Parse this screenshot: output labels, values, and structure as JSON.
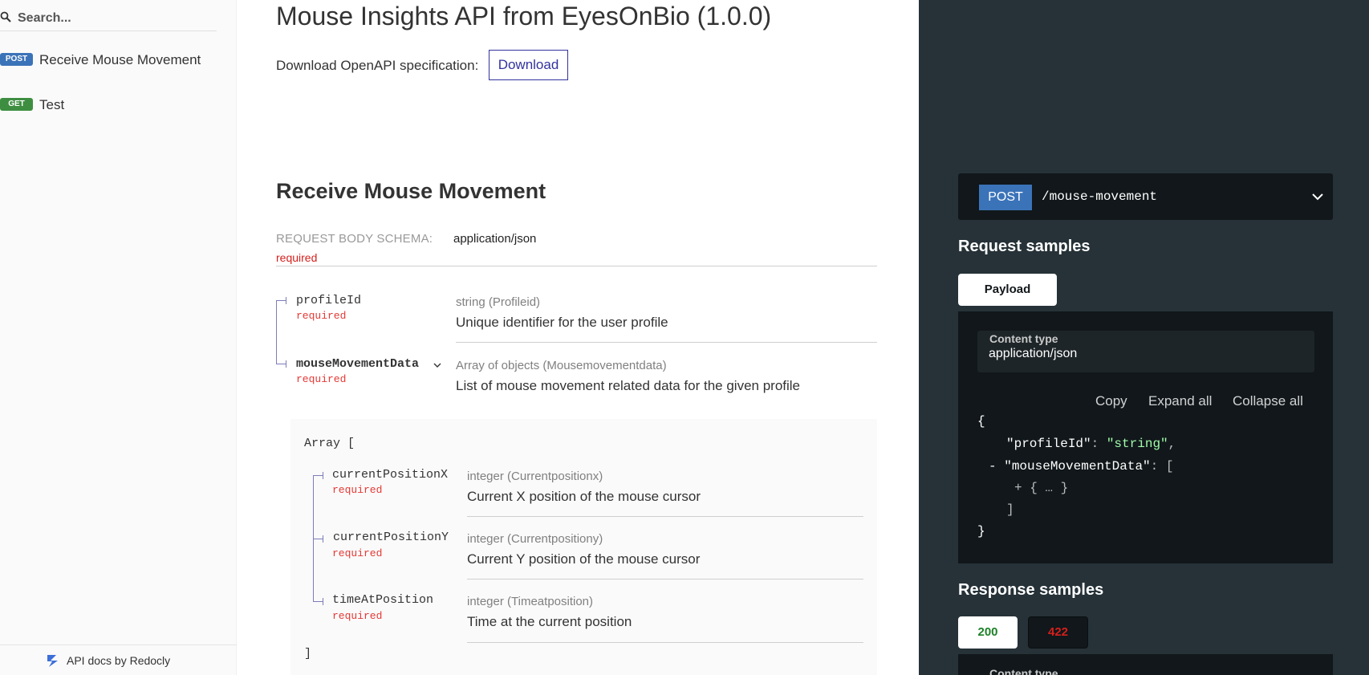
{
  "sidebar": {
    "search_placeholder": "Search...",
    "items": [
      {
        "method": "POST",
        "label": "Receive Mouse Movement",
        "color": "#3b73b9"
      },
      {
        "method": "GET",
        "label": "Test",
        "color": "#3e8e41"
      }
    ],
    "footer": "API docs by Redocly"
  },
  "main": {
    "api_title": "Mouse Insights API from EyesOnBio (1.0.0)",
    "download_text": "Download OpenAPI specification:",
    "download_button": "Download",
    "operation_title": "Receive Mouse Movement",
    "schema_label": "REQUEST BODY SCHEMA:",
    "schema_content_type": "application/json",
    "schema_required": "required",
    "properties": [
      {
        "name": "profileId",
        "required": "required",
        "type": "string (Profileid)",
        "description": "Unique identifier for the user profile"
      },
      {
        "name": "mouseMovementData",
        "required": "required",
        "type": "Array of objects (Mousemovementdata)",
        "description": "List of mouse movement related data for the given profile"
      }
    ],
    "array_open": "Array [",
    "array_close": "]",
    "array_items": [
      {
        "name": "currentPositionX",
        "required": "required",
        "type": "integer (Currentpositionx)",
        "description": "Current X position of the mouse cursor"
      },
      {
        "name": "currentPositionY",
        "required": "required",
        "type": "integer (Currentpositiony)",
        "description": "Current Y position of the mouse cursor"
      },
      {
        "name": "timeAtPosition",
        "required": "required",
        "type": "integer (Timeatposition)",
        "description": "Time at the current position"
      }
    ]
  },
  "right": {
    "endpoint": {
      "method": "POST",
      "path": "/mouse-movement"
    },
    "request_samples_heading": "Request samples",
    "request_tab": "Payload",
    "content_type_label": "Content type",
    "content_type_value": "application/json",
    "code_tools": {
      "copy": "Copy",
      "expand": "Expand all",
      "collapse": "Collapse all"
    },
    "code": {
      "open": "{",
      "k1": "\"profileId\"",
      "v1": "\"string\"",
      "dash": "-",
      "k2": "\"mouseMovementData\"",
      "open_arr": "[",
      "collapsed": "+ { … }",
      "close_arr": "]",
      "close": "}"
    },
    "response_samples_heading": "Response samples",
    "response_tabs": [
      {
        "label": "200",
        "color": "#1d8127"
      },
      {
        "label": "422",
        "color": "#d41f1c"
      }
    ],
    "response_content_type_label": "Content type"
  }
}
